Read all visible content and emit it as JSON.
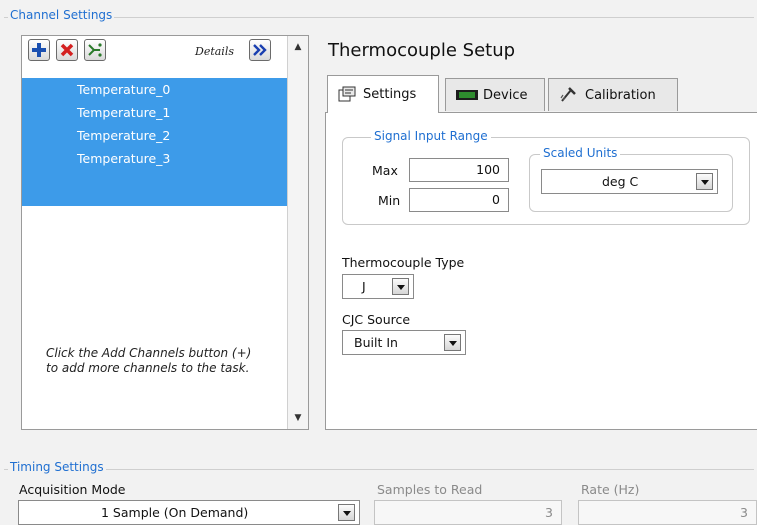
{
  "channel_settings": {
    "title": "Channel Settings",
    "details_label": "Details",
    "channels": [
      "Temperature_0",
      "Temperature_1",
      "Temperature_2",
      "Temperature_3"
    ],
    "help_text": "Click the Add Channels button (+) to add more channels to the task."
  },
  "setup": {
    "title": "Thermocouple Setup",
    "tabs": [
      "Settings",
      "Device",
      "Calibration"
    ],
    "active_tab": "Settings",
    "signal_input_range": {
      "title": "Signal Input Range",
      "max_label": "Max",
      "max_value": "100",
      "min_label": "Min",
      "min_value": "0"
    },
    "scaled_units": {
      "title": "Scaled Units",
      "value": "deg C"
    },
    "thermocouple_type": {
      "label": "Thermocouple Type",
      "value": "J"
    },
    "cjc_source": {
      "label": "CJC Source",
      "value": "Built In"
    }
  },
  "timing_settings": {
    "title": "Timing Settings",
    "acquisition_mode_label": "Acquisition Mode",
    "acquisition_mode_value": "1 Sample (On Demand)",
    "samples_label": "Samples to Read",
    "samples_value": "3",
    "rate_label": "Rate (Hz)",
    "rate_value": "3"
  },
  "colors": {
    "accent": "#1f6fd1",
    "selection": "#3d9be9"
  },
  "icons": {
    "add": "plus-icon",
    "remove": "x-icon",
    "configure": "channel-config-icon",
    "details": "double-chevron-right-icon"
  }
}
